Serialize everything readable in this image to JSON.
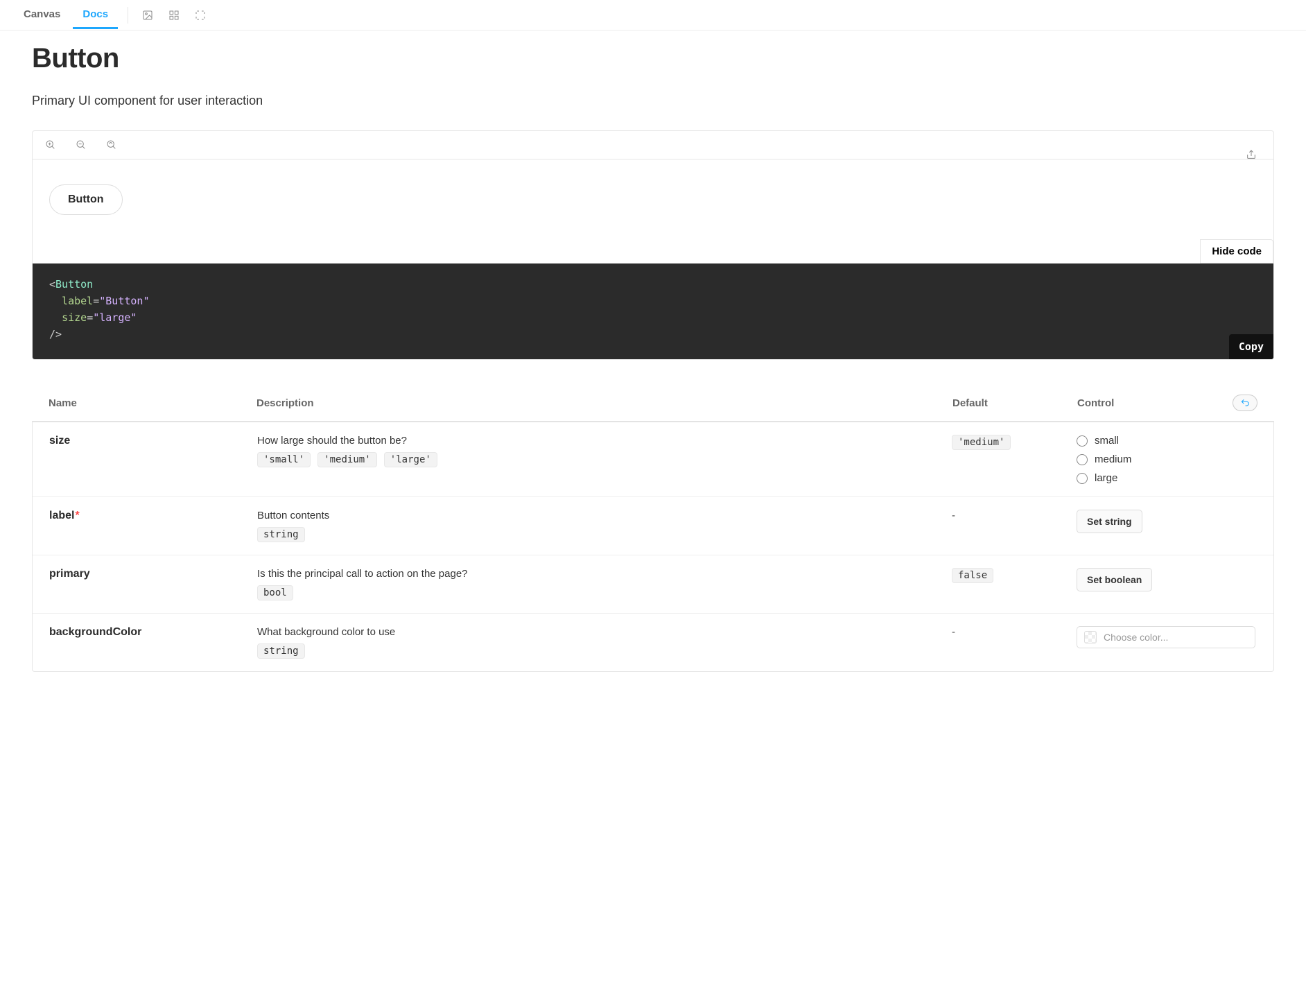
{
  "tabs": {
    "canvas": "Canvas",
    "docs": "Docs"
  },
  "page": {
    "title": "Button",
    "subtitle": "Primary UI component for user interaction"
  },
  "preview": {
    "button_label": "Button",
    "hide_code": "Hide code",
    "copy": "Copy"
  },
  "code": {
    "open": "<",
    "component": "Button",
    "attr1_name": "label",
    "attr1_value": "\"Button\"",
    "attr2_name": "size",
    "attr2_value": "\"large\"",
    "close": "/>"
  },
  "args": {
    "headers": {
      "name": "Name",
      "description": "Description",
      "default": "Default",
      "control": "Control"
    },
    "rows": {
      "size": {
        "name": "size",
        "desc": "How large should the button be?",
        "options": [
          "'small'",
          "'medium'",
          "'large'"
        ],
        "default": "'medium'",
        "radios": [
          "small",
          "medium",
          "large"
        ]
      },
      "label": {
        "name": "label",
        "required": "*",
        "desc": "Button contents",
        "type": "string",
        "default": "-",
        "control": "Set string"
      },
      "primary": {
        "name": "primary",
        "desc": "Is this the principal call to action on the page?",
        "type": "bool",
        "default": "false",
        "control": "Set boolean"
      },
      "backgroundColor": {
        "name": "backgroundColor",
        "desc": "What background color to use",
        "type": "string",
        "default": "-",
        "placeholder": "Choose color..."
      }
    }
  }
}
